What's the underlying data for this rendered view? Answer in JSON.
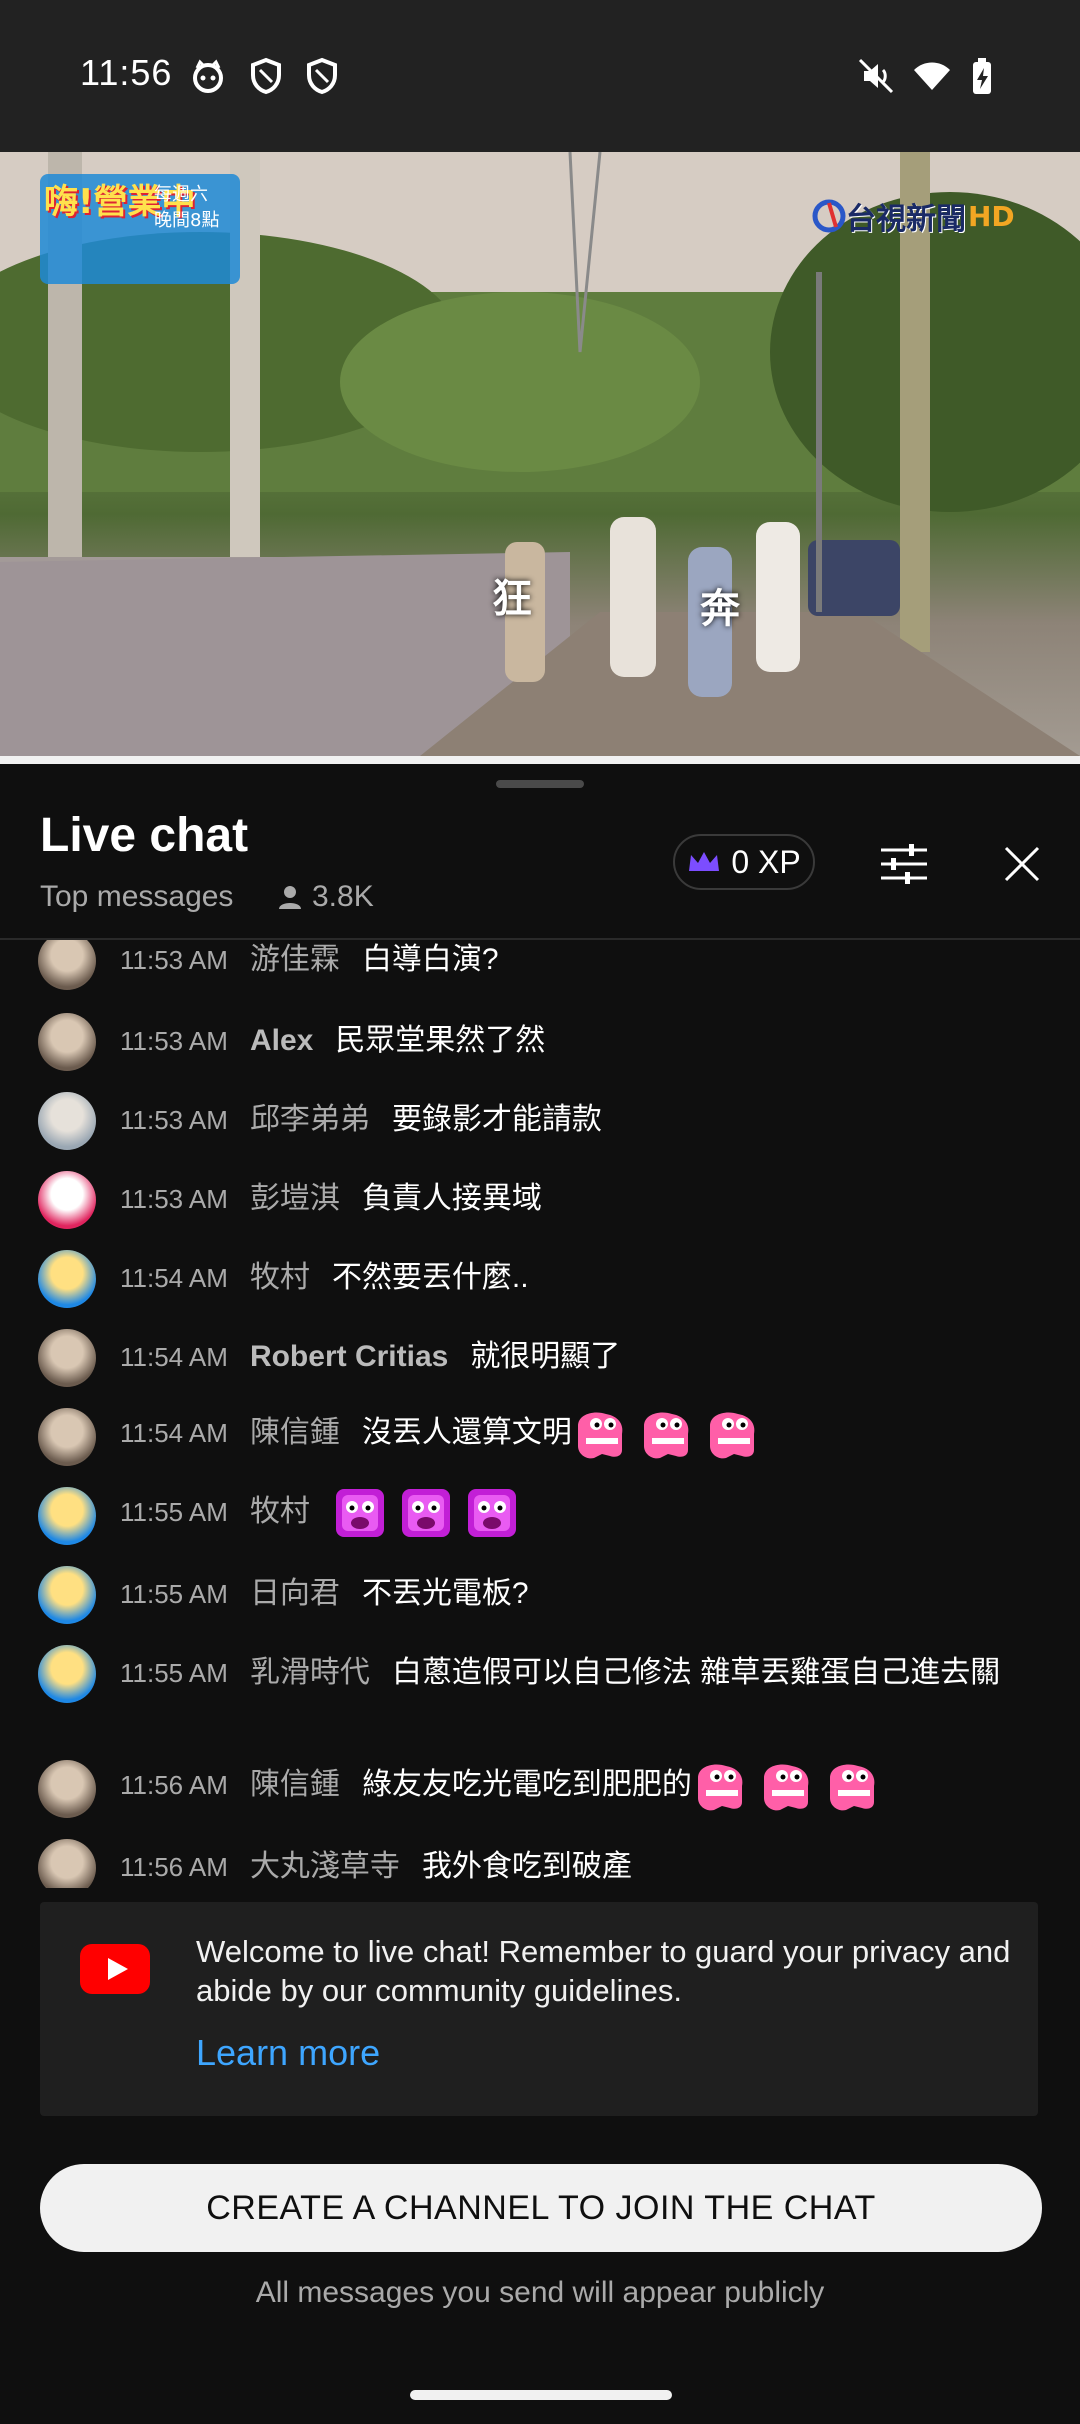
{
  "status_bar": {
    "time": "11:56",
    "left_icons": [
      "cat-face-icon",
      "shield-icon",
      "shield-icon"
    ],
    "right_icons": [
      "mute-icon",
      "wifi-icon",
      "battery-charging-icon"
    ]
  },
  "video": {
    "channel_logo_text": "台視新聞",
    "channel_logo_hd": "HD",
    "show_logo_lines": [
      "嗨!營業中",
      "每週六",
      "晚間8點"
    ],
    "caption_left": "狂",
    "caption_right": "奔"
  },
  "chat_header": {
    "title": "Live chat",
    "subtitle": "Top messages",
    "viewer_count": "3.8K",
    "xp_label": "0 XP",
    "accent_color": "#7c4dff"
  },
  "messages": [
    {
      "time": "11:53 AM",
      "author": "游佳霖",
      "text": "白導白演?",
      "avatar": "avatar-photo",
      "bold": false,
      "emotes": []
    },
    {
      "time": "11:53 AM",
      "author": "Alex",
      "text": "民眾堂果然了然",
      "avatar": "avatar-photo",
      "bold": true,
      "emotes": []
    },
    {
      "time": "11:53 AM",
      "author": "邱李弟弟",
      "text": "要錄影才能請款",
      "avatar": "avatar-dog",
      "bold": false,
      "emotes": []
    },
    {
      "time": "11:53 AM",
      "author": "彭塏淇",
      "text": "負責人接異域",
      "avatar": "avatar-default",
      "bold": false,
      "emotes": []
    },
    {
      "time": "11:54 AM",
      "author": "牧村",
      "text": "不然要丟什麼..",
      "avatar": "avatar-cartoon",
      "bold": false,
      "emotes": []
    },
    {
      "time": "11:54 AM",
      "author": "Robert Critias",
      "text": "就很明顯了",
      "avatar": "avatar-photo",
      "bold": true,
      "emotes": []
    },
    {
      "time": "11:54 AM",
      "author": "陳信鍾",
      "text": "沒丟人還算文明",
      "avatar": "avatar-photo",
      "bold": false,
      "emotes": [
        "pink-dino-emote",
        "pink-dino-emote",
        "pink-dino-emote"
      ]
    },
    {
      "time": "11:55 AM",
      "author": "牧村",
      "text": "",
      "avatar": "avatar-cartoon",
      "bold": false,
      "emotes": [
        "purple-face-emote",
        "purple-face-emote",
        "purple-face-emote"
      ]
    },
    {
      "time": "11:55 AM",
      "author": "日向君",
      "text": "不丟光電板?",
      "avatar": "avatar-cartoon",
      "bold": false,
      "emotes": []
    },
    {
      "time": "11:55 AM",
      "author": "乳滑時代",
      "text": "白蔥造假可以自己修法 雜草丟雞蛋自己進去關",
      "avatar": "avatar-cartoon",
      "bold": false,
      "emotes": []
    },
    {
      "time": "11:56 AM",
      "author": "陳信鍾",
      "text": "綠友友吃光電吃到肥肥的",
      "avatar": "avatar-photo",
      "bold": false,
      "emotes": [
        "pink-dino-emote",
        "pink-dino-emote",
        "pink-dino-emote"
      ]
    },
    {
      "time": "11:56 AM",
      "author": "大丸淺草寺",
      "text": "我外食吃到破產",
      "avatar": "avatar-photo",
      "bold": false,
      "emotes": []
    }
  ],
  "welcome": {
    "text": "Welcome to live chat! Remember to guard your privacy and abide by our community guidelines.",
    "link": "Learn more"
  },
  "create_button": "CREATE A CHANNEL TO JOIN THE CHAT",
  "public_note": "All messages you send will appear publicly"
}
